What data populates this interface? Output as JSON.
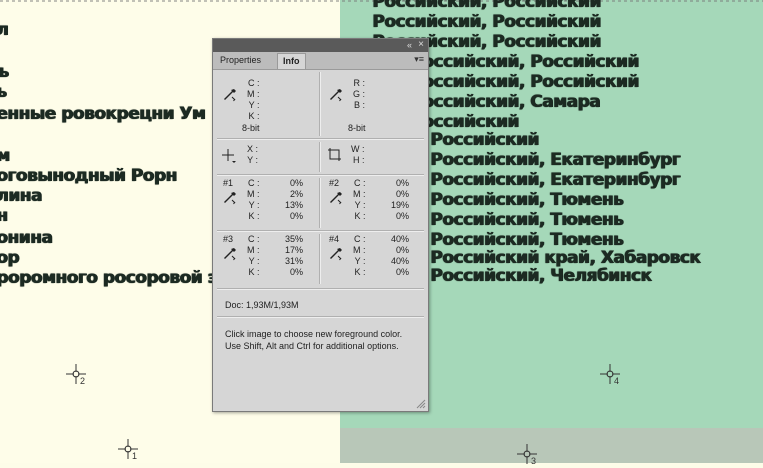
{
  "document": {
    "left_lines": [
      "л",
      "ъ",
      "ь",
      "т",
      "енные ровокрецни Ум",
      "м",
      "оговынодный Рорн",
      "лина",
      "н",
      "онина",
      "ор",
      "роромного росоровой э"
    ],
    "right_lines": [
      "Российский, Российский",
      "Российский, Российский",
      "Российский, Российский",
      "Российский, Российский",
      "Российский, Российский",
      "Российский, Самара",
      "Российский",
      "Российский",
      "Российский, Екатеринбург",
      "Российский, Тюмень",
      "Российский, Тюмень",
      "Российский, Тюмень",
      "Российский край, Хабаровск",
      "Российский, Челябинск"
    ],
    "markers": [
      "2",
      "4",
      "1",
      "3"
    ]
  },
  "panel": {
    "tabs": {
      "properties": "Properties",
      "info": "Info"
    },
    "collapse_icon": "«",
    "close_icon": "×",
    "menu_icon": "▾≡",
    "top_left": {
      "labels": [
        "C :",
        "M :",
        "Y :",
        "K :"
      ],
      "values": [
        "",
        "",
        "",
        ""
      ],
      "bit": "8-bit"
    },
    "top_right": {
      "labels": [
        "R :",
        "G :",
        "B :"
      ],
      "values": [
        "",
        "",
        ""
      ],
      "bit": "8-bit"
    },
    "pos": {
      "labels": [
        "X :",
        "Y :"
      ],
      "values": [
        "",
        ""
      ]
    },
    "size": {
      "labels": [
        "W :",
        "H :"
      ],
      "values": [
        "",
        ""
      ]
    },
    "samplers": [
      {
        "id": "#1",
        "labels": [
          "C :",
          "M :",
          "Y :",
          "K :"
        ],
        "values": [
          "0%",
          "2%",
          "13%",
          "0%"
        ]
      },
      {
        "id": "#2",
        "labels": [
          "C :",
          "M :",
          "Y :",
          "K :"
        ],
        "values": [
          "0%",
          "0%",
          "19%",
          "0%"
        ]
      },
      {
        "id": "#3",
        "labels": [
          "C :",
          "M :",
          "Y :",
          "K :"
        ],
        "values": [
          "35%",
          "17%",
          "31%",
          "0%"
        ]
      },
      {
        "id": "#4",
        "labels": [
          "C :",
          "M :",
          "Y :",
          "K :"
        ],
        "values": [
          "40%",
          "0%",
          "40%",
          "0%"
        ]
      }
    ],
    "doc": "Doc: 1,93M/1,93M",
    "help": "Click image to choose new foreground color.  Use Shift, Alt and Ctrl for additional options."
  },
  "colors": {
    "left_bg": "#fefde9",
    "right_bg": "#a5d8b9",
    "text": "#1c2a22",
    "panel_bg": "#d6d6d6"
  }
}
